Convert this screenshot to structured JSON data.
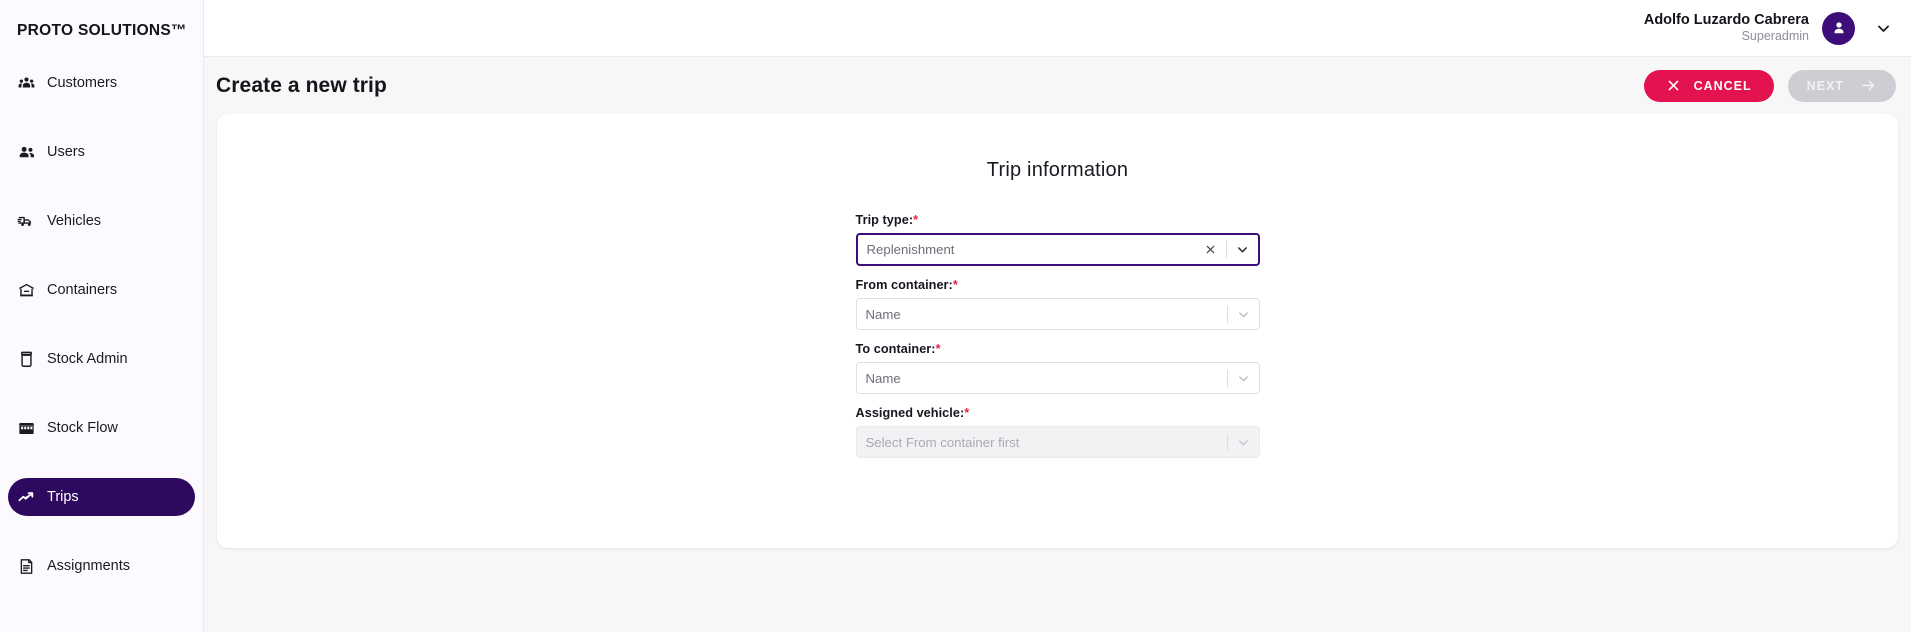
{
  "sidebar": {
    "brand": "PROTO SOLUTIONS™",
    "items": [
      {
        "label": "Customers",
        "icon": "customers-icon",
        "active": false
      },
      {
        "label": "Users",
        "icon": "users-icon",
        "active": false
      },
      {
        "label": "Vehicles",
        "icon": "vehicles-icon",
        "active": false
      },
      {
        "label": "Containers",
        "icon": "containers-icon",
        "active": false
      },
      {
        "label": "Stock Admin",
        "icon": "stock-admin-icon",
        "active": false
      },
      {
        "label": "Stock Flow",
        "icon": "stock-flow-icon",
        "active": false
      },
      {
        "label": "Trips",
        "icon": "trips-icon",
        "active": true
      },
      {
        "label": "Assignments",
        "icon": "assignments-icon",
        "active": false
      }
    ],
    "active_bg": "#2d0a5f"
  },
  "topbar": {
    "user_name": "Adolfo Luzardo Cabrera",
    "user_role": "Superadmin",
    "avatar_icon": "person-icon",
    "caret_icon": "chevron-down-icon",
    "avatar_color": "#3d0e79"
  },
  "page": {
    "title": "Create a new trip",
    "cancel_label": "CANCEL",
    "cancel_icon": "close-icon",
    "cancel_color": "#e2134f",
    "next_label": "NEXT",
    "next_icon": "arrow-right-icon",
    "next_color": "#cdced3",
    "next_disabled": true
  },
  "card": {
    "title": "Trip information",
    "fields": [
      {
        "label": "Trip type:",
        "required": "*",
        "value": "Replenishment",
        "placeholder": "Replenishment",
        "focused": true,
        "disabled": false,
        "has_clear": true,
        "clear_icon": "close-icon",
        "chevron_icon": "chevron-down-icon"
      },
      {
        "label": "From container:",
        "required": "*",
        "value": "Name",
        "placeholder": "Name",
        "focused": false,
        "disabled": false,
        "has_clear": false,
        "chevron_icon": "chevron-down-icon"
      },
      {
        "label": "To container:",
        "required": "*",
        "value": "Name",
        "placeholder": "Name",
        "focused": false,
        "disabled": false,
        "has_clear": false,
        "chevron_icon": "chevron-down-icon"
      },
      {
        "label": "Assigned vehicle:",
        "required": "*",
        "value": "Select From container first",
        "placeholder": "Select From container first",
        "focused": false,
        "disabled": true,
        "has_clear": false,
        "chevron_icon": "chevron-down-icon"
      }
    ]
  }
}
